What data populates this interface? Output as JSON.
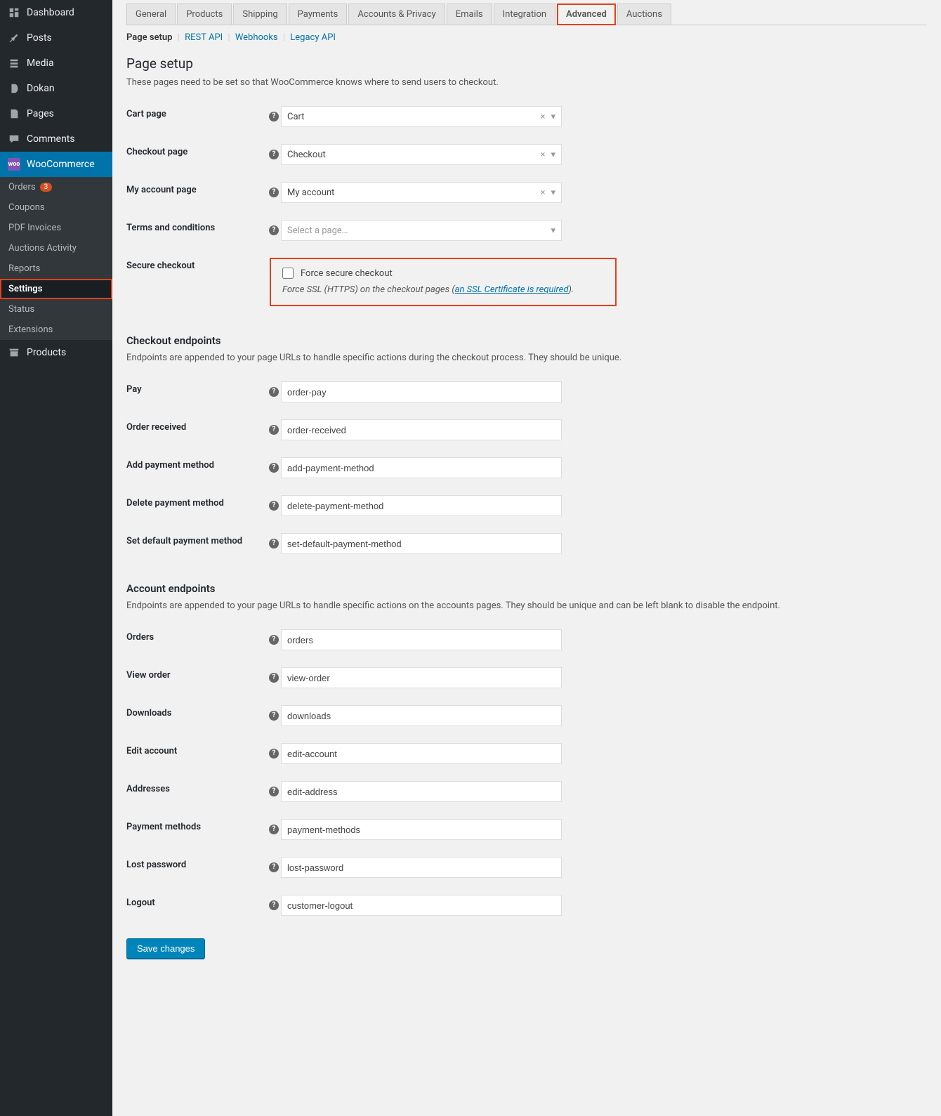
{
  "sidebar": {
    "items": [
      {
        "label": "Dashboard",
        "icon": "dashboard"
      },
      {
        "label": "Posts",
        "icon": "pin"
      },
      {
        "label": "Media",
        "icon": "media"
      },
      {
        "label": "Dokan",
        "icon": "dokan"
      },
      {
        "label": "Pages",
        "icon": "pages"
      },
      {
        "label": "Comments",
        "icon": "comments"
      },
      {
        "label": "WooCommerce",
        "icon": "woo",
        "active": true
      }
    ],
    "sub": [
      {
        "label": "Orders",
        "badge": "3"
      },
      {
        "label": "Coupons"
      },
      {
        "label": "PDF Invoices"
      },
      {
        "label": "Auctions Activity"
      },
      {
        "label": "Reports"
      },
      {
        "label": "Settings",
        "selected": true
      },
      {
        "label": "Status"
      },
      {
        "label": "Extensions"
      }
    ],
    "bottom": [
      {
        "label": "Products",
        "icon": "archive"
      }
    ]
  },
  "tabs": [
    "General",
    "Products",
    "Shipping",
    "Payments",
    "Accounts & Privacy",
    "Emails",
    "Integration",
    "Advanced",
    "Auctions"
  ],
  "subtabs": [
    "Page setup",
    "REST API",
    "Webhooks",
    "Legacy API"
  ],
  "page_setup": {
    "heading": "Page setup",
    "desc": "These pages need to be set so that WooCommerce knows where to send users to checkout.",
    "fields": {
      "cart": {
        "label": "Cart page",
        "value": "Cart"
      },
      "checkout": {
        "label": "Checkout page",
        "value": "Checkout"
      },
      "account": {
        "label": "My account page",
        "value": "My account"
      },
      "terms": {
        "label": "Terms and conditions",
        "placeholder": "Select a page…"
      },
      "secure": {
        "label": "Secure checkout",
        "chk_label": "Force secure checkout",
        "hint_pre": "Force SSL (HTTPS) on the checkout pages (",
        "hint_link": "an SSL Certificate is required",
        "hint_post": ")."
      }
    }
  },
  "checkout_ep": {
    "heading": "Checkout endpoints",
    "desc": "Endpoints are appended to your page URLs to handle specific actions during the checkout process. They should be unique.",
    "fields": [
      {
        "label": "Pay",
        "value": "order-pay"
      },
      {
        "label": "Order received",
        "value": "order-received"
      },
      {
        "label": "Add payment method",
        "value": "add-payment-method"
      },
      {
        "label": "Delete payment method",
        "value": "delete-payment-method"
      },
      {
        "label": "Set default payment method",
        "value": "set-default-payment-method"
      }
    ]
  },
  "account_ep": {
    "heading": "Account endpoints",
    "desc": "Endpoints are appended to your page URLs to handle specific actions on the accounts pages. They should be unique and can be left blank to disable the endpoint.",
    "fields": [
      {
        "label": "Orders",
        "value": "orders"
      },
      {
        "label": "View order",
        "value": "view-order"
      },
      {
        "label": "Downloads",
        "value": "downloads"
      },
      {
        "label": "Edit account",
        "value": "edit-account"
      },
      {
        "label": "Addresses",
        "value": "edit-address"
      },
      {
        "label": "Payment methods",
        "value": "payment-methods"
      },
      {
        "label": "Lost password",
        "value": "lost-password"
      },
      {
        "label": "Logout",
        "value": "customer-logout"
      }
    ]
  },
  "save_label": "Save changes"
}
